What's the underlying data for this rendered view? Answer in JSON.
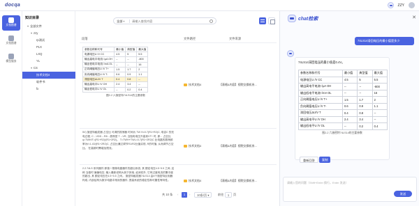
{
  "app": {
    "logo": "docqa",
    "user_name": "ZZY"
  },
  "rail": [
    {
      "label": "文档图谱",
      "icon": "graph-icon",
      "active": true
    },
    {
      "label": "文档图谱",
      "icon": "doc-icon",
      "active": false
    },
    {
      "label": "模型服务",
      "icon": "model-icon",
      "active": false
    }
  ],
  "tree": {
    "title": "知识目录",
    "items": [
      {
        "label": "全部文件",
        "level": 1,
        "caret": "▾"
      },
      {
        "label": "zzy",
        "level": 2,
        "caret": "▾"
      },
      {
        "label": "rp测试",
        "level": 3,
        "caret": ""
      },
      {
        "label": "PLX",
        "level": 3,
        "caret": ""
      },
      {
        "label": "LXQ",
        "level": 3,
        "caret": ""
      },
      {
        "label": "YL",
        "level": 3,
        "caret": ""
      },
      {
        "label": "CS",
        "level": 2,
        "caret": "▾"
      },
      {
        "label": "技术文档4",
        "level": 3,
        "caret": "",
        "selected": true
      },
      {
        "label": "软件书",
        "level": 3,
        "caret": ""
      },
      {
        "label": "fx",
        "level": 3,
        "caret": ""
      }
    ]
  },
  "search": {
    "scope": "全部",
    "placeholder": "请输入查找内容"
  },
  "table": {
    "headers": [
      "段落",
      "文件路径",
      "文件来源"
    ],
    "rows": [
      {
        "file": "技术文档4",
        "source": "【表格&内容】视院交换机系...",
        "param_table": [
          [
            "参数名称和代号",
            "最小值",
            "典型值",
            "最大值"
          ],
          [
            "电源电压U /V CC",
            "4.5",
            "5",
            "5.5"
          ],
          [
            "输出高电平电流I /μA OH",
            "--",
            "--",
            "-800"
          ],
          [
            "输出低电平电流I /mA OL",
            "--",
            "--",
            "16"
          ],
          [
            "正向阈值电压U /V T+",
            "1.5",
            "1.7",
            "2"
          ],
          [
            "负向阈值电压U /V T-",
            "0.6",
            "0.9",
            "1.1"
          ],
          [
            "滞回电压ΔU/V T",
            "0.4",
            "0.8",
            "--"
          ],
          [
            "输出高电平U /V OH",
            "2.4",
            "3.4",
            "--"
          ],
          [
            "输出低电平U /V OL",
            "--",
            "0.2",
            "0.4"
          ]
        ],
        "caption": "图2-2 六施密特74LS14的主要参数"
      },
      {
        "file": "技术文档4",
        "source": "【表格&内容】视院交换机系...",
        "text": "5V) 施密特触发器 占空比 可调的振荡器 时间为 TW H=0.7(R1+R2)C, 电容C 的充电过程, C→VDD→R8→振荡型 T→VR, 当阻电电压升高到VT+ 时, 即... 占空比 q=TWH/T=(R1+R2)/(R1+2R2)。 T=TWH+TWL=0.7(R1+2R2)C 比电路的振荡频率为f=1.43/(R1+2R2)C, 占空比通过调节R1/R2比值实现, R的时值, 从而调节占空比。 在高频时需增加限流。"
      },
      {
        "file": "技术文档4",
        "source": "【表格&内容】视院交换机系...",
        "text": "2.2.74LS 系列器件 即施一般微电路器件的超出系统, 其 额定电压4.5~5.5 之间, 这种 当做时 偏偏电压, 输入最新说明大到于其他, 如消初外, 它有过度电流的集中度的超出, 其 额定电压在4.5~5.5 之间。 施密特触发器74LS14 由6个施密特反相器构成, 内部结构为数字电路中常用的器件, 提高系统的稳定性和可靠性等特性。"
      }
    ]
  },
  "pager": {
    "total": "共 10 条",
    "page": "1",
    "page_size": "10条/页",
    "goto_label": "前往",
    "goto_value": "1",
    "page_suffix": "页"
  },
  "chat": {
    "title": "chat检索",
    "user_message": "74LS14滞回电压的最小值是多少",
    "bot_intro": "74LS14滞回电压的最小值是0.4V。",
    "bot_table": [
      [
        "参数名称和代号",
        "最小值",
        "典型值",
        "最大值"
      ],
      [
        "电源电压U /V CC",
        "4.5",
        "5",
        "5.5"
      ],
      [
        "输出高电平电流I /μA OH",
        "--",
        "--",
        "-800"
      ],
      [
        "输出低电平电流I /mA OL",
        "--",
        "--",
        "16"
      ],
      [
        "正向阈值电压U /V T+",
        "1.5",
        "1.7",
        "2"
      ],
      [
        "负向阈值电压U /V T-",
        "0.6",
        "0.9",
        "1.1"
      ],
      [
        "滞回电压ΔU/V T",
        "0.4",
        "0.8",
        "--"
      ],
      [
        "输出高电平U /V OH",
        "2.4",
        "3.4",
        "--"
      ],
      [
        "输出低电平U /V OL",
        "--",
        "0.2",
        "0.4"
      ]
    ],
    "bot_caption": "图2-2 六施密特74LS14的主要参数",
    "regen_label": "重新回答",
    "copy_label": "复制",
    "input_placeholder": "请输入您的问题（Shift+Enter 换行，Enter 发送）",
    "send_label": "发送"
  }
}
